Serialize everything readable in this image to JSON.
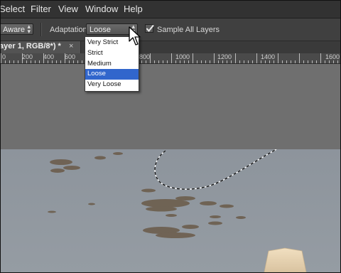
{
  "menu": {
    "items": [
      "Select",
      "Filter",
      "View",
      "Window",
      "Help"
    ]
  },
  "options_bar": {
    "mode_value": "Aware",
    "adaptation_label": "Adaptation:",
    "adaptation_value": "Loose",
    "sample_all_layers_label": "Sample All Layers",
    "sample_all_layers_checked": true
  },
  "adaptation_dropdown": {
    "options": [
      "Very Strict",
      "Strict",
      "Medium",
      "Loose",
      "Very Loose"
    ],
    "selected": "Loose"
  },
  "document_tab": {
    "title": "ayer 1, RGB/8*) *",
    "close": "×"
  },
  "ruler": {
    "labels": [
      "0",
      "200",
      "400",
      "600",
      "800",
      "1000",
      "1200",
      "1400",
      "1600"
    ]
  },
  "colors": {
    "selection_highlight": "#3166cc",
    "water": "#8f979f",
    "rock": "#ebd7b9"
  },
  "icons": {
    "dropdown_arrow": "up-down-arrow-icon",
    "checkbox": "checkmark-icon",
    "cursor": "arrow-pointer-icon"
  }
}
